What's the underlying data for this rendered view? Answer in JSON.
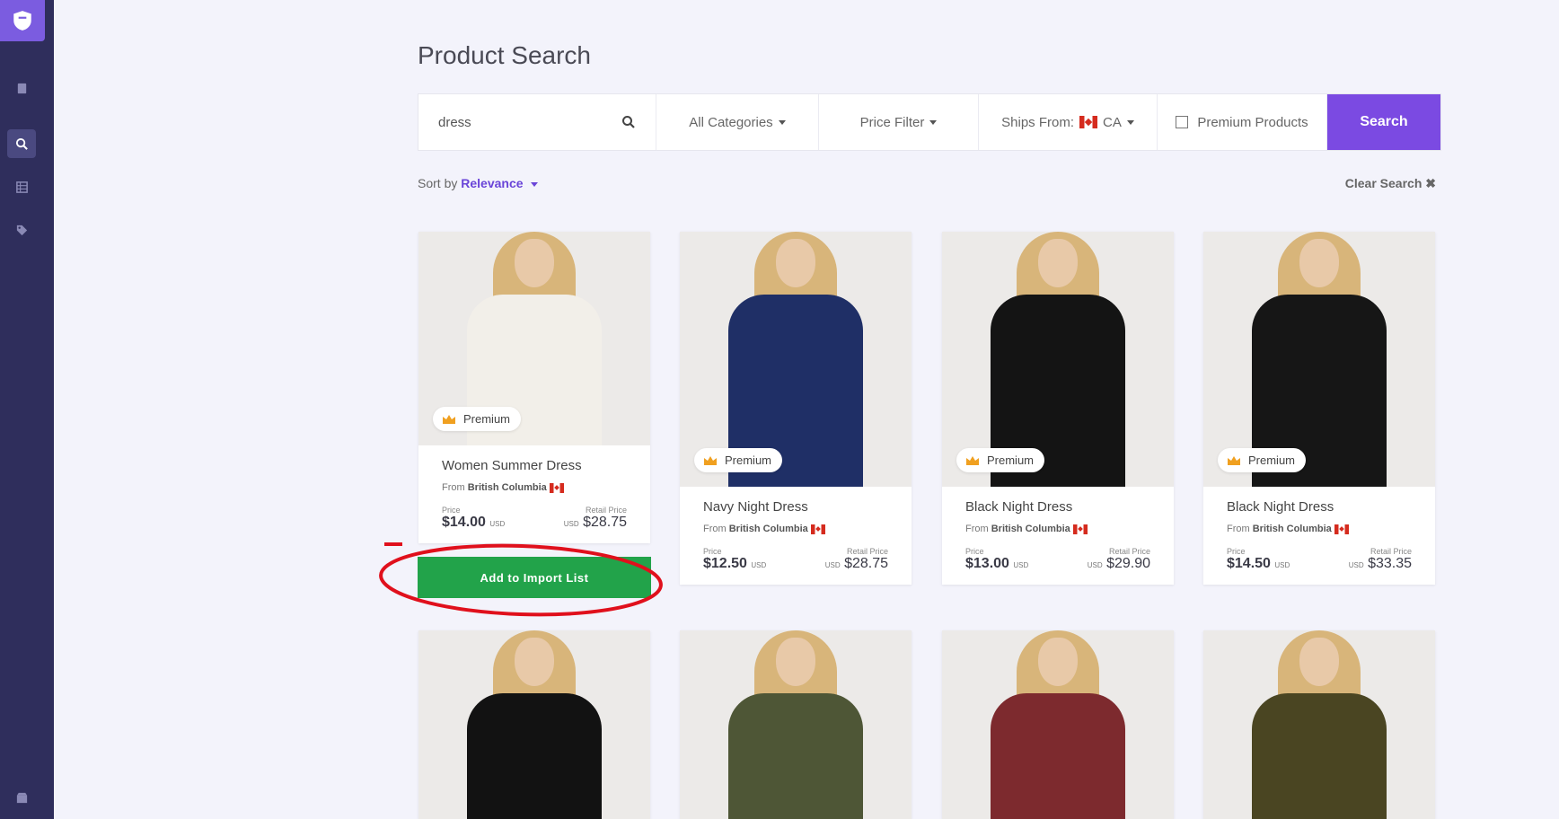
{
  "page": {
    "title": "Product Search"
  },
  "search": {
    "value": "dress"
  },
  "filters": {
    "categories": "All Categories",
    "price": "Price Filter",
    "ships_from_label": "Ships From:",
    "ships_from_value": "CA",
    "premium_label": "Premium Products",
    "search_button": "Search"
  },
  "sort": {
    "label": "Sort by",
    "value": "Relevance"
  },
  "clear_search": "Clear Search",
  "products": [
    {
      "name": "Women Summer Dress",
      "from_label": "From",
      "region": "British Columbia",
      "price_label": "Price",
      "price": "$14.00",
      "price_currency": "USD",
      "retail_label": "Retail Price",
      "retail_currency": "USD",
      "retail": "$28.75",
      "badge": "Premium",
      "color": "#f2efe9"
    },
    {
      "name": "Navy Night Dress",
      "from_label": "From",
      "region": "British Columbia",
      "price_label": "Price",
      "price": "$12.50",
      "price_currency": "USD",
      "retail_label": "Retail Price",
      "retail_currency": "USD",
      "retail": "$28.75",
      "badge": "Premium",
      "color": "#1f2f66"
    },
    {
      "name": "Black Night Dress",
      "from_label": "From",
      "region": "British Columbia",
      "price_label": "Price",
      "price": "$13.00",
      "price_currency": "USD",
      "retail_label": "Retail Price",
      "retail_currency": "USD",
      "retail": "$29.90",
      "badge": "Premium",
      "color": "#141414"
    },
    {
      "name": "Black Night Dress",
      "from_label": "From",
      "region": "British Columbia",
      "price_label": "Price",
      "price": "$14.50",
      "price_currency": "USD",
      "retail_label": "Retail Price",
      "retail_currency": "USD",
      "retail": "$33.35",
      "badge": "Premium",
      "color": "#161616"
    }
  ],
  "import_button": "Add to Import List",
  "second_row_colors": [
    "#121212",
    "#4e5636",
    "#7d2a2e",
    "#4a4522"
  ]
}
